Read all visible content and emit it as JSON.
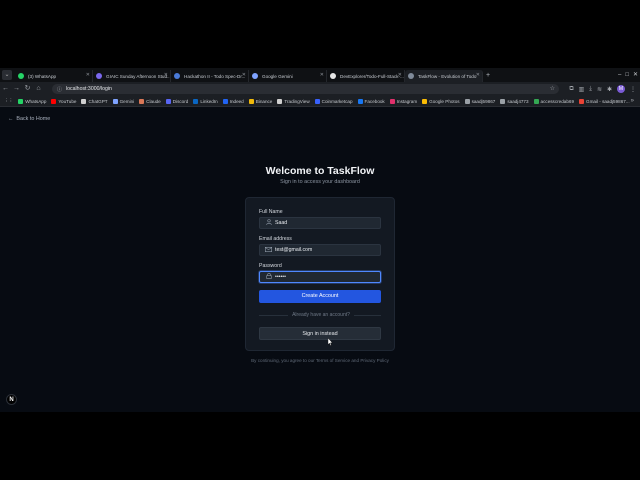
{
  "browser": {
    "tabs": [
      {
        "label": "(3) WhatsApp",
        "color": "#25d366"
      },
      {
        "label": "GIAIC Sunday Afternoon Stud...",
        "color": "#7b68ee"
      },
      {
        "label": "Hackathon II - Todo Spec-Dr...",
        "color": "#4a7bd9"
      },
      {
        "label": "Google Gemini",
        "color": "#7fa3ff"
      },
      {
        "label": "DevExplorer/Todo-Full-Stack-...",
        "color": "#e6e6e6"
      },
      {
        "label": "TaskFlow - Evolution of Todo",
        "color": "#7f8a99"
      }
    ],
    "url": "localhost:3000/login",
    "avatar_letter": "M",
    "bookmarks": [
      {
        "label": "WhatsApp",
        "color": "#25d366"
      },
      {
        "label": "YouTube",
        "color": "#ff0000"
      },
      {
        "label": "ChatGPT",
        "color": "#d0d0d0"
      },
      {
        "label": "Gemini",
        "color": "#7fa3ff"
      },
      {
        "label": "Claude",
        "color": "#d97757"
      },
      {
        "label": "Discord",
        "color": "#5865f2"
      },
      {
        "label": "LinkedIn",
        "color": "#0a66c2"
      },
      {
        "label": "Indeed",
        "color": "#2164f3"
      },
      {
        "label": "Binance",
        "color": "#f0b90b"
      },
      {
        "label": "TradingView",
        "color": "#d0d0d0"
      },
      {
        "label": "Coinmarketcap",
        "color": "#3861fb"
      },
      {
        "label": "Facebook",
        "color": "#1877f2"
      },
      {
        "label": "Instagram",
        "color": "#e1306c"
      },
      {
        "label": "Google Photos",
        "color": "#fbbc04"
      },
      {
        "label": "saadj59867",
        "color": "#9aa0a6"
      },
      {
        "label": "saadj4773",
        "color": "#9aa0a6"
      },
      {
        "label": "accesscredab69",
        "color": "#34a853"
      },
      {
        "label": "Gmail - saadj59867...",
        "color": "#ea4335"
      }
    ]
  },
  "page": {
    "back_label": "Back to Home",
    "title": "Welcome to TaskFlow",
    "subtitle": "Sign in to access your dashboard",
    "form": {
      "name_label": "Full Name",
      "name_value": "Saad",
      "email_label": "Email address",
      "email_value": "test@gmail.com",
      "password_label": "Password",
      "password_value": "••••••",
      "submit_label": "Create Account",
      "divider_label": "Already have an account?",
      "signin_label": "Sign in instead"
    },
    "terms_prefix": "By continuing, you agree to our",
    "terms_link": "Terms of Service",
    "terms_and": "and",
    "privacy_link": "Privacy Policy",
    "next_badge": "N"
  }
}
